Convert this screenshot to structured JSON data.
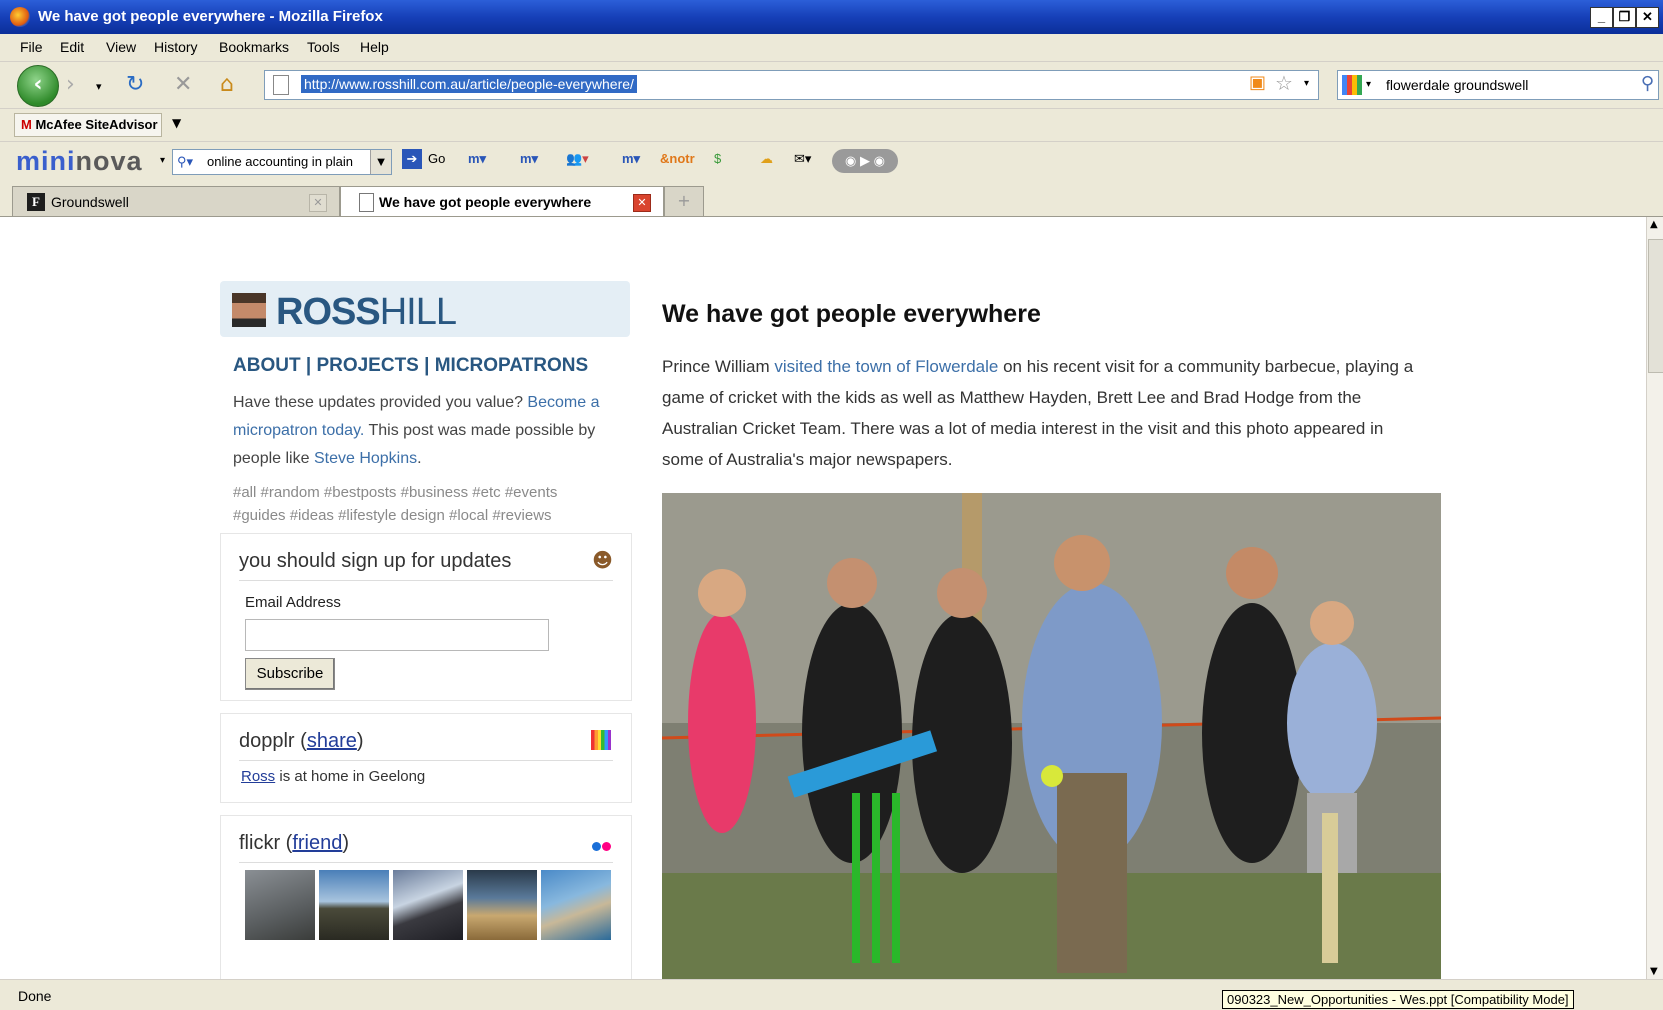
{
  "window": {
    "title": "We have got people everywhere - Mozilla Firefox"
  },
  "menu": [
    "File",
    "Edit",
    "View",
    "History",
    "Bookmarks",
    "Tools",
    "Help"
  ],
  "navbar": {
    "url": "http://www.rosshill.com.au/article/people-everywhere/",
    "search_value": "flowerdale groundswell"
  },
  "bookmarks": {
    "mcafee_label": "McAfee SiteAdvisor"
  },
  "mininova": {
    "logo_a": "mini",
    "logo_b": "nova",
    "search_value": "online accounting in plain",
    "go_label": "Go",
    "notr_label": "notr"
  },
  "tabs": [
    {
      "label": "Groundswell",
      "active": false
    },
    {
      "label": "We have got people everywhere",
      "active": true
    }
  ],
  "sidebar": {
    "brand_bold": "ROSS",
    "brand_thin": "HILL",
    "nav": {
      "about": "ABOUT",
      "projects": "PROJECTS",
      "micropatrons": "MICROPATRONS",
      "sep": " | "
    },
    "value_text_1": "Have these updates provided you value? ",
    "value_link": "Become a micropatron today.",
    "value_text_2": " This post was made possible by people like ",
    "value_link_2": "Steve Hopkins",
    "value_text_3": ".",
    "tags_line1": "#all #random #bestposts #business #etc #events",
    "tags_line2": "#guides #ideas #lifestyle design #local #reviews",
    "signup": {
      "heading": "you should sign up for updates",
      "email_label": "Email Address",
      "email_value": "",
      "subscribe_label": "Subscribe"
    },
    "dopplr": {
      "heading": "dopplr",
      "link": "share",
      "user_link": "Ross",
      "status": " is at home in Geelong"
    },
    "flickr": {
      "heading": "flickr",
      "link": "friend"
    }
  },
  "article": {
    "title": "We have got people everywhere",
    "p1_a": "Prince William ",
    "p1_link": "visited the town of Flowerdale",
    "p1_b": " on his recent visit for a community barbecue, playing a game of cricket with the kids as well as Matthew Hayden, Brett Lee and Brad Hodge from the Australian Cricket Team. There was a lot of media interest in the visit and this photo appeared in some of Australia's major newspapers."
  },
  "status": {
    "text": "Done",
    "tooltip": "090323_New_Opportunities - Wes.ppt [Compatibility Mode]"
  },
  "colors": {
    "brand_blue": "#295781",
    "link_blue": "#3c6fa8",
    "titlebar": "#1640b8",
    "chrome": "#ece9d8"
  },
  "icons": {
    "back": "back-arrow-icon",
    "forward": "forward-arrow-icon",
    "reload": "reload-icon",
    "stop": "stop-icon",
    "home": "home-icon",
    "rss": "rss-feed-icon",
    "bookmark": "star-bookmark-icon",
    "search": "magnifier-icon"
  }
}
